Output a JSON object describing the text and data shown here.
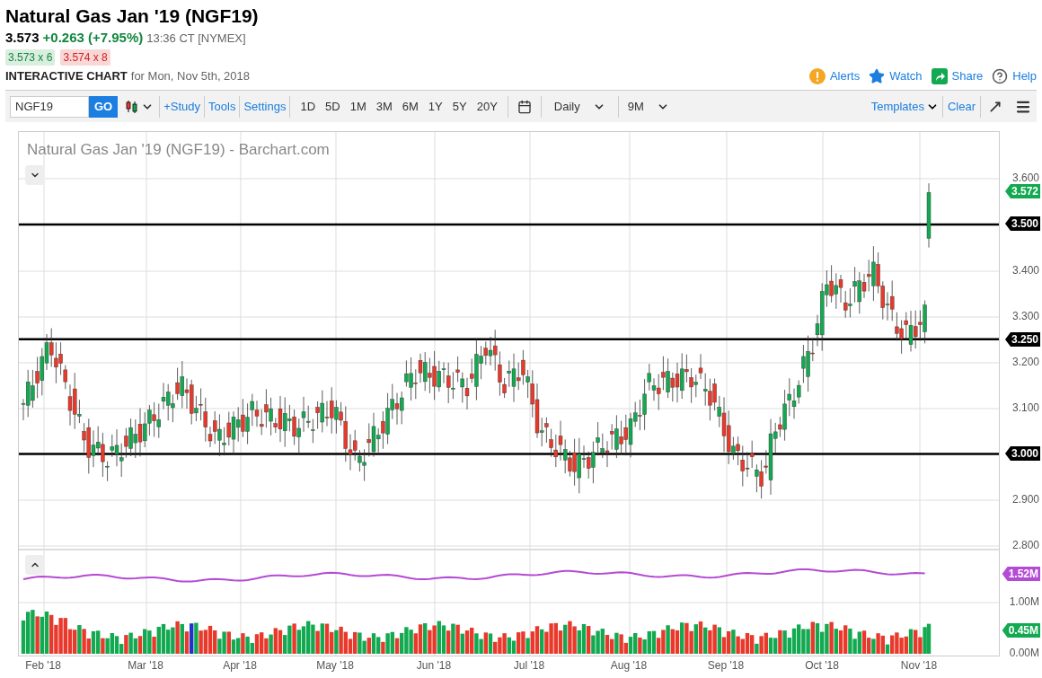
{
  "quote": {
    "title": "Natural Gas Jan '19 (NGF19)",
    "last": "3.573",
    "change": "+0.263 (+7.95%)",
    "time": "13:36 CT [NYMEX]",
    "bid": "3.573 x 6",
    "ask": "3.574 x 8"
  },
  "chart_heading": {
    "label": "INTERACTIVE CHART",
    "date": "for Mon, Nov 5th, 2018"
  },
  "actions": [
    {
      "kind": "alert",
      "label": "Alerts"
    },
    {
      "kind": "watch",
      "label": "Watch"
    },
    {
      "kind": "share",
      "label": "Share"
    },
    {
      "kind": "help",
      "label": "Help"
    }
  ],
  "toolbar": {
    "symbol": "NGF19",
    "go": "GO",
    "links": [
      "+Study",
      "Tools",
      "Settings"
    ],
    "ranges": [
      "1D",
      "5D",
      "1M",
      "3M",
      "6M",
      "1Y",
      "5Y",
      "20Y"
    ],
    "interval": "Daily",
    "period": "9M",
    "templates": "Templates",
    "clear": "Clear"
  },
  "chart": {
    "title": "Natural Gas Jan '19 (NGF19) - Barchart.com",
    "axis_labels": [
      {
        "kind": "tick",
        "text": "3.600"
      },
      {
        "kind": "badge",
        "text": "3.572",
        "color": "#12a950"
      },
      {
        "kind": "badge",
        "text": "3.500",
        "color": "#000000"
      },
      {
        "kind": "tick",
        "text": "3.400"
      },
      {
        "kind": "tick",
        "text": "3.300"
      },
      {
        "kind": "badge",
        "text": "3.250",
        "color": "#000000"
      },
      {
        "kind": "tick",
        "text": "3.200"
      },
      {
        "kind": "tick",
        "text": "3.100"
      },
      {
        "kind": "badge",
        "text": "3.000",
        "color": "#000000"
      },
      {
        "kind": "tick",
        "text": "2.900"
      },
      {
        "kind": "tick",
        "text": "2.800"
      },
      {
        "kind": "badge",
        "text": "1.52M",
        "color": "#b44bd4"
      },
      {
        "kind": "tick",
        "text": "1.00M"
      },
      {
        "kind": "badge",
        "text": "0.45M",
        "color": "#12a950"
      },
      {
        "kind": "tick",
        "text": "0.00M"
      }
    ],
    "months": [
      "Feb '18",
      "Mar '18",
      "Apr '18",
      "May '18",
      "Jun '18",
      "Jul '18",
      "Aug '18",
      "Sep '18",
      "Oct '18",
      "Nov '18"
    ]
  }
}
